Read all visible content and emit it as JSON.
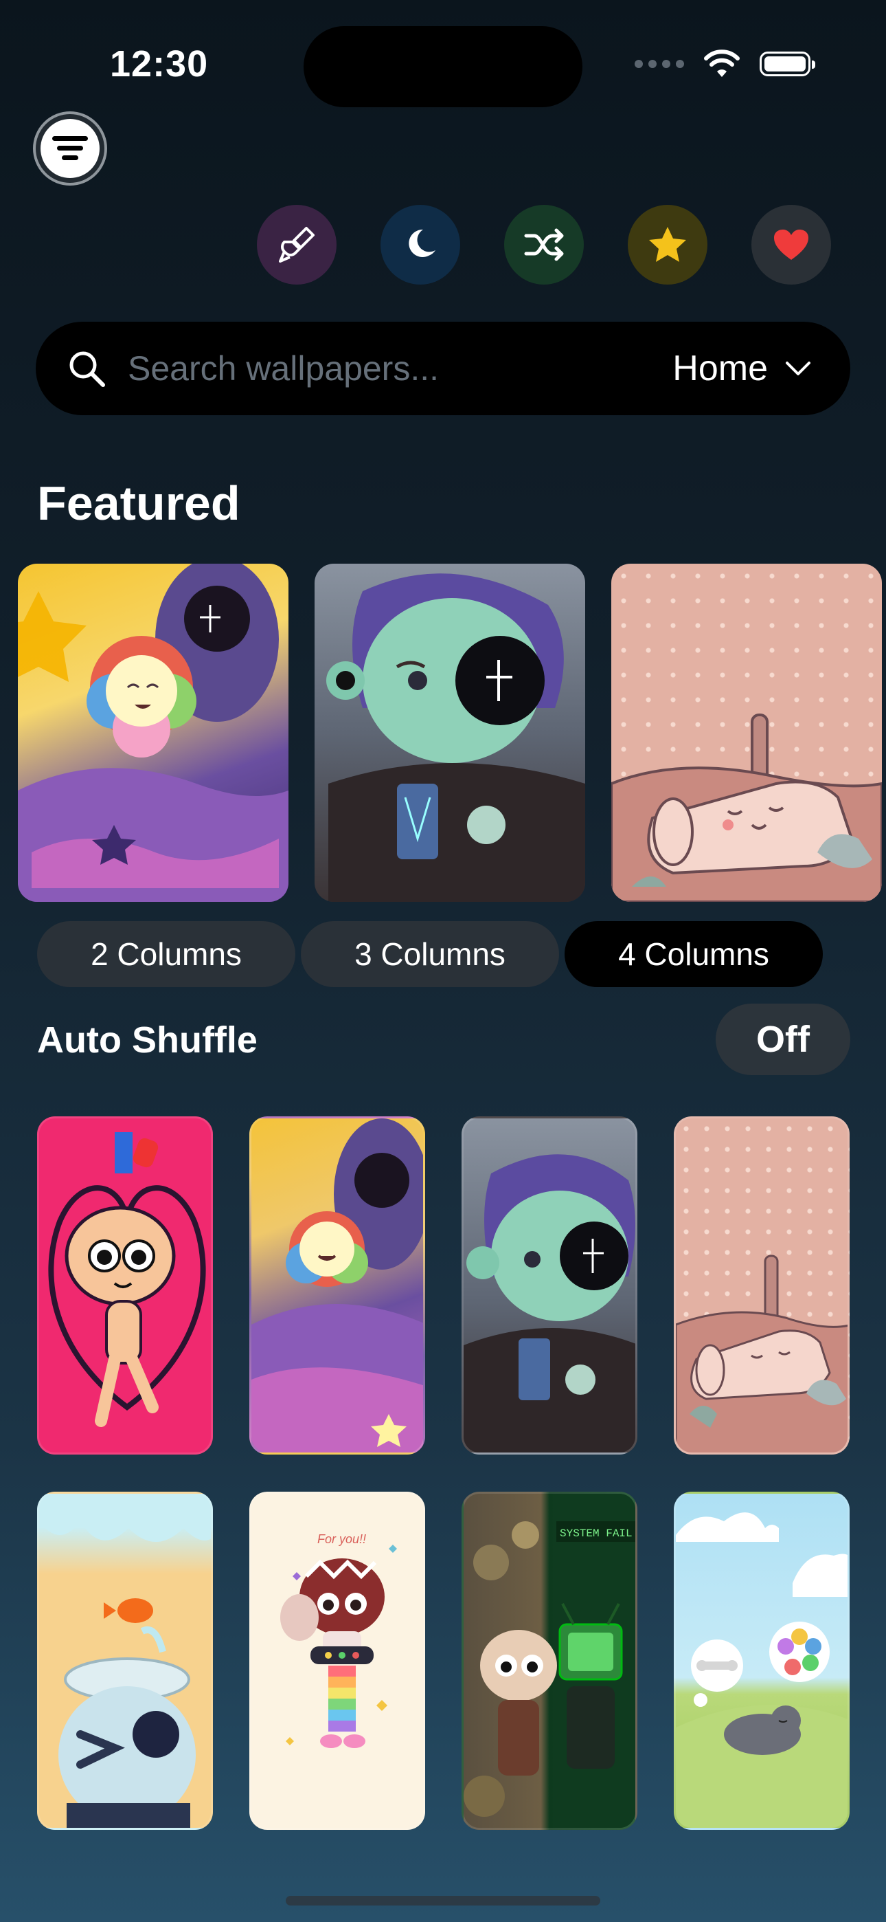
{
  "status_bar": {
    "time": "12:30"
  },
  "header": {
    "menu_icon": "menu-lines-icon",
    "quick_actions": [
      {
        "name": "paintbrush-icon",
        "color": "#3a2344"
      },
      {
        "name": "moon-icon",
        "color": "#0f2c47"
      },
      {
        "name": "shuffle-icon",
        "color": "#163a27"
      },
      {
        "name": "star-icon",
        "color": "#3e3a10"
      },
      {
        "name": "heart-icon",
        "color": "#2a3036"
      }
    ]
  },
  "search": {
    "placeholder": "Search wallpapers...",
    "category": "Home"
  },
  "featured": {
    "title": "Featured",
    "items": [
      {
        "name": "featured-wallpaper-1",
        "theme": "hooded figure and flower on stars"
      },
      {
        "name": "featured-wallpaper-2",
        "theme": "green character with phone"
      },
      {
        "name": "featured-wallpaper-3",
        "theme": "sleeping toast on pink dots"
      }
    ]
  },
  "columns": {
    "options": [
      "2 Columns",
      "3 Columns",
      "4 Columns"
    ],
    "selected": "4 Columns"
  },
  "auto_shuffle": {
    "label": "Auto Shuffle",
    "value": "Off"
  },
  "grid": {
    "items": [
      {
        "name": "wallpaper-heart-character"
      },
      {
        "name": "wallpaper-hooded-flower"
      },
      {
        "name": "wallpaper-green-character"
      },
      {
        "name": "wallpaper-sleeping-toast"
      },
      {
        "name": "wallpaper-fishbowl"
      },
      {
        "name": "wallpaper-for-you",
        "text": "For you!!"
      },
      {
        "name": "wallpaper-system-fail",
        "text": "SYSTEM FAIL"
      },
      {
        "name": "wallpaper-dreaming-pet"
      }
    ]
  },
  "colors": {
    "accent_star": "#f4c21b",
    "accent_heart": "#ef3b3b",
    "background_top": "#0b151d",
    "background_bottom": "#27506a"
  }
}
